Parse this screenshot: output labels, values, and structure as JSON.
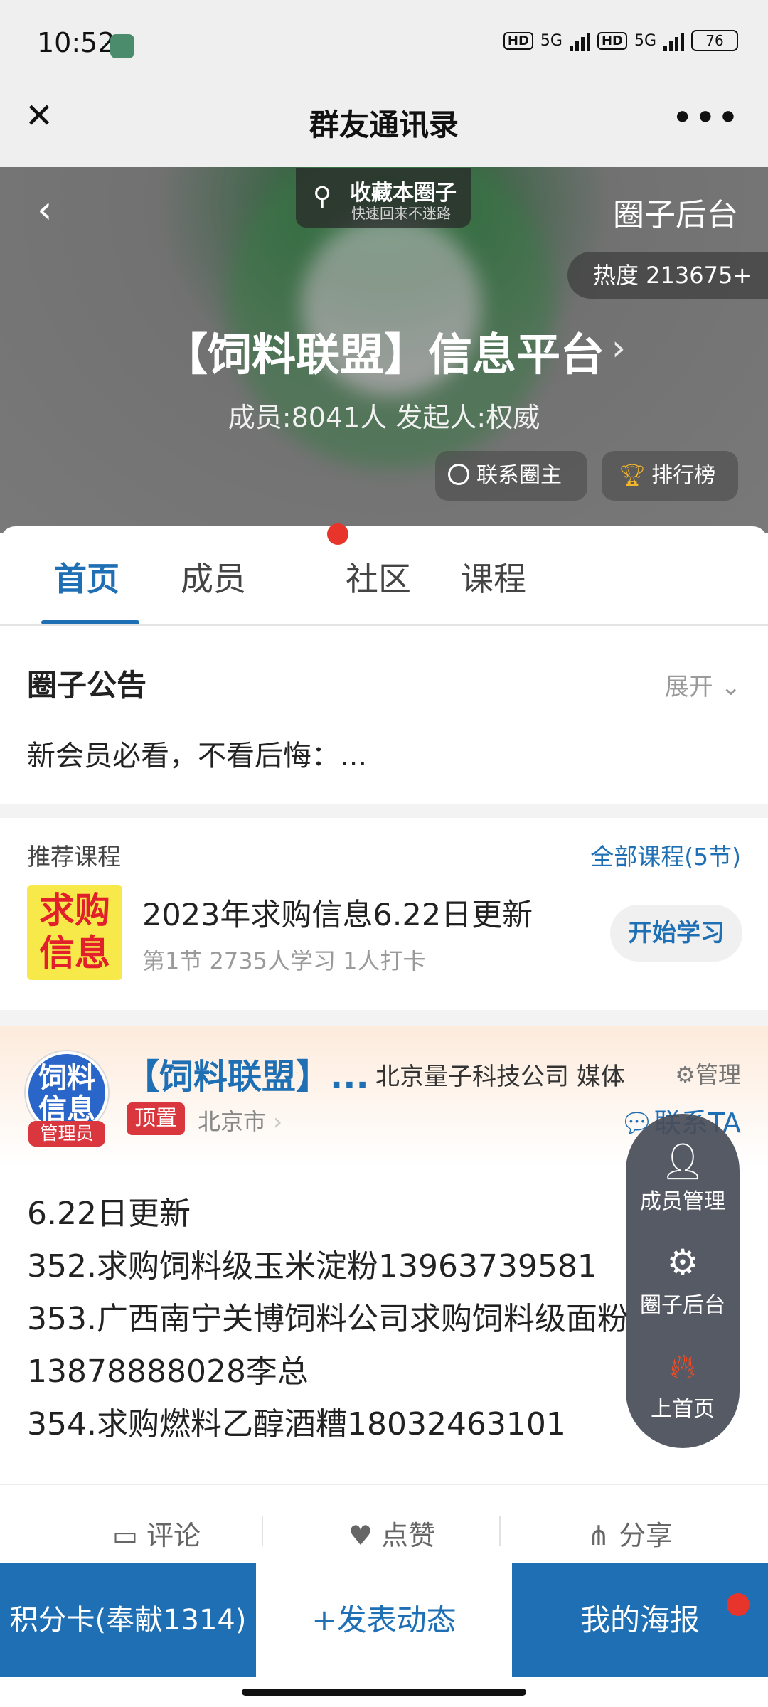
{
  "status_bar": {
    "time": "10:52",
    "network_labels": [
      "HD",
      "5G",
      "HD",
      "5G"
    ],
    "battery": "76"
  },
  "nav": {
    "title": "群友通讯录",
    "close_icon": "close-icon",
    "more_icon": "more-icon"
  },
  "header": {
    "collect_title": "收藏本圈子",
    "collect_sub": "快速回来不迷路",
    "backend": "圈子后台",
    "heat": "热度 213675+",
    "circle_name": "【饲料联盟】信息平台",
    "members": "成员:8041人 发起人:权威",
    "contact_owner": "联系圈主",
    "rank": "排行榜"
  },
  "tabs": [
    "首页",
    "成员",
    "社区",
    "课程"
  ],
  "notice": {
    "title": "圈子公告",
    "expand": "展开",
    "text": "新会员必看，不看后悔：..."
  },
  "recommend": {
    "title": "推荐课程",
    "all": "全部课程(5节)",
    "thumb_line1": "求购",
    "thumb_line2": "信息",
    "course_name": "2023年求购信息6.22日更新",
    "course_meta": "第1节  2735人学习  1人打卡",
    "study_button": "开始学习"
  },
  "post": {
    "avatar_line1": "饲料",
    "avatar_line2": "信息",
    "admin": "管理员",
    "name": "【饲料联盟】...",
    "org": "北京量子科技公司 媒体",
    "manage": "管理",
    "pin": "顶置",
    "location": "北京市",
    "contact_ta": "联系TA",
    "lines": [
      "6.22日更新",
      "352.求购饲料级玉米淀粉13963739581",
      "353.广西南宁关博饲料公司求购饲料级面粉",
      "13878888028李总",
      "354.求购燃料乙醇酒糟18032463101"
    ]
  },
  "actions": {
    "comment": "评论",
    "like": "点赞",
    "share": "分享"
  },
  "float_menu": {
    "member_manage": "成员管理",
    "circle_backend": "圈子后台",
    "to_front": "上首页"
  },
  "bottom_bar": {
    "points": "积分卡(奉献1314)",
    "publish": "+发表动态",
    "poster": "我的海报"
  },
  "colors": {
    "accent": "#1f6fb5",
    "red": "#e8352b",
    "badge_red": "#d9363e"
  }
}
